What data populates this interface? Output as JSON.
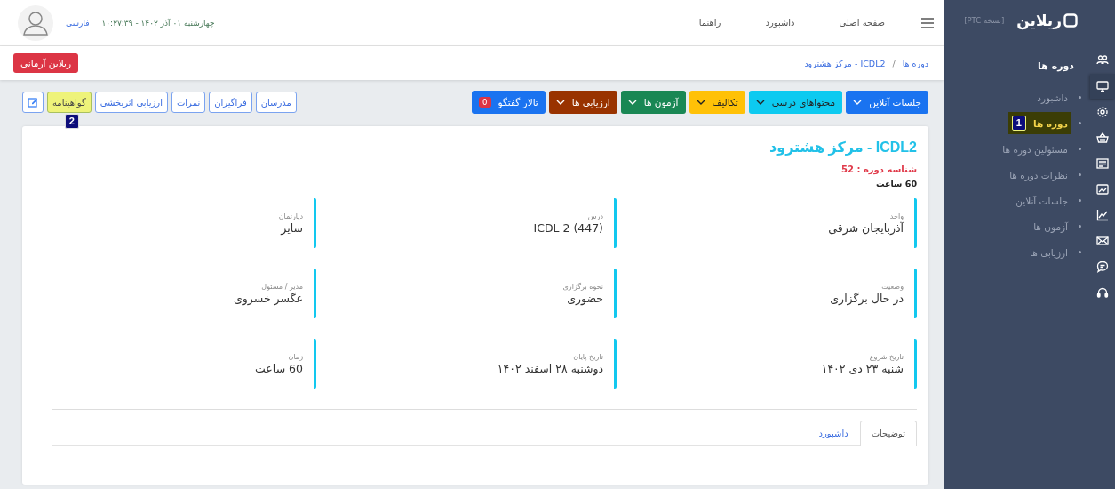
{
  "header": {
    "nav": [
      "صفحه اصلی",
      "داشبورد",
      "راهنما"
    ],
    "datetime": "چهارشنبه ۰۱ آذر ۱۴۰۲ - ۱۰:۲۷:۳۹",
    "language": "فارسی"
  },
  "breadcrumb": {
    "items": [
      "دوره ها",
      "ICDL2 - مرکز هشترود"
    ],
    "separator": "/"
  },
  "org_button": "ریلاین آرمانی",
  "toolbar": {
    "menus": [
      {
        "label": "جلسات آنلاین",
        "kind": "dropdown",
        "color": "#1a73f0"
      },
      {
        "label": "محتواهای درسی",
        "kind": "dropdown",
        "color": "#0dcaf0"
      },
      {
        "label": "تکالیف",
        "kind": "dropdown",
        "color": "#ffc107"
      },
      {
        "label": "آزمون ها",
        "kind": "dropdown",
        "color": "#198754"
      },
      {
        "label": "ارزیابی ها",
        "kind": "dropdown",
        "color": "#993300"
      },
      {
        "label": "تالار گفتگو",
        "kind": "counter",
        "color": "#1a73f0",
        "count": "0"
      }
    ],
    "links": [
      {
        "label": "مدرسان",
        "kind": "text",
        "highlighted": false
      },
      {
        "label": "فراگیران",
        "kind": "text",
        "highlighted": false
      },
      {
        "label": "نمرات",
        "kind": "text",
        "highlighted": false
      },
      {
        "label": "ارزیابی اثربخشی",
        "kind": "text",
        "highlighted": false
      },
      {
        "label": "گواهینامه",
        "kind": "text",
        "highlighted": true,
        "marker": "2"
      },
      {
        "kind": "edit",
        "highlighted": false
      }
    ]
  },
  "course": {
    "title": "ICDL2 - مرکز هشترود",
    "id_line": "شناسه دوره : 52",
    "hours": "60 ساعت",
    "fields": [
      {
        "label": "واحد",
        "value": "آذربایجان شرقی"
      },
      {
        "label": "درس",
        "value": "ICDL 2 (447)"
      },
      {
        "label": "دپارتمان",
        "value": "سایر"
      },
      {
        "label": "وضعیت",
        "value": "در حال برگزاری"
      },
      {
        "label": "نحوه برگزاری",
        "value": "حضوری"
      },
      {
        "label": "مدیر / مسئول",
        "value": "عگسر خسروی"
      },
      {
        "label": "تاریخ شروع",
        "value": "شنبه ۲۳ دی ۱۴۰۲"
      },
      {
        "label": "تاریخ پایان",
        "value": "دوشنبه ۲۸ اسفند ۱۴۰۲"
      },
      {
        "label": "زمان",
        "value": "60 ساعت"
      }
    ],
    "tabs": [
      {
        "label": "توضیحات",
        "selected": true
      },
      {
        "label": "داشبورد",
        "selected": false
      }
    ]
  },
  "sidebar": {
    "logo": "ریلاین",
    "version": "[نسخه PTC]",
    "section": "دوره ها",
    "items": [
      {
        "label": "داشبورد",
        "selected": false
      },
      {
        "label": "دوره ها",
        "selected": true,
        "marker": "1"
      },
      {
        "label": "مسئولین دوره ها",
        "selected": false
      },
      {
        "label": "نظرات دوره ها",
        "selected": false
      },
      {
        "label": "جلسات آنلاین",
        "selected": false
      },
      {
        "label": "آزمون ها",
        "selected": false
      },
      {
        "label": "ارزیابی ها",
        "selected": false
      }
    ],
    "icons": [
      {
        "kind": "people",
        "selected": false
      },
      {
        "kind": "monitor",
        "selected": true
      },
      {
        "kind": "gear",
        "selected": false
      },
      {
        "kind": "basket",
        "selected": false
      },
      {
        "kind": "newspaper",
        "selected": false
      },
      {
        "kind": "picture",
        "selected": false
      },
      {
        "kind": "chart",
        "selected": false
      },
      {
        "kind": "mail",
        "selected": false
      },
      {
        "kind": "chat",
        "selected": false
      },
      {
        "kind": "headset",
        "selected": false
      }
    ]
  }
}
